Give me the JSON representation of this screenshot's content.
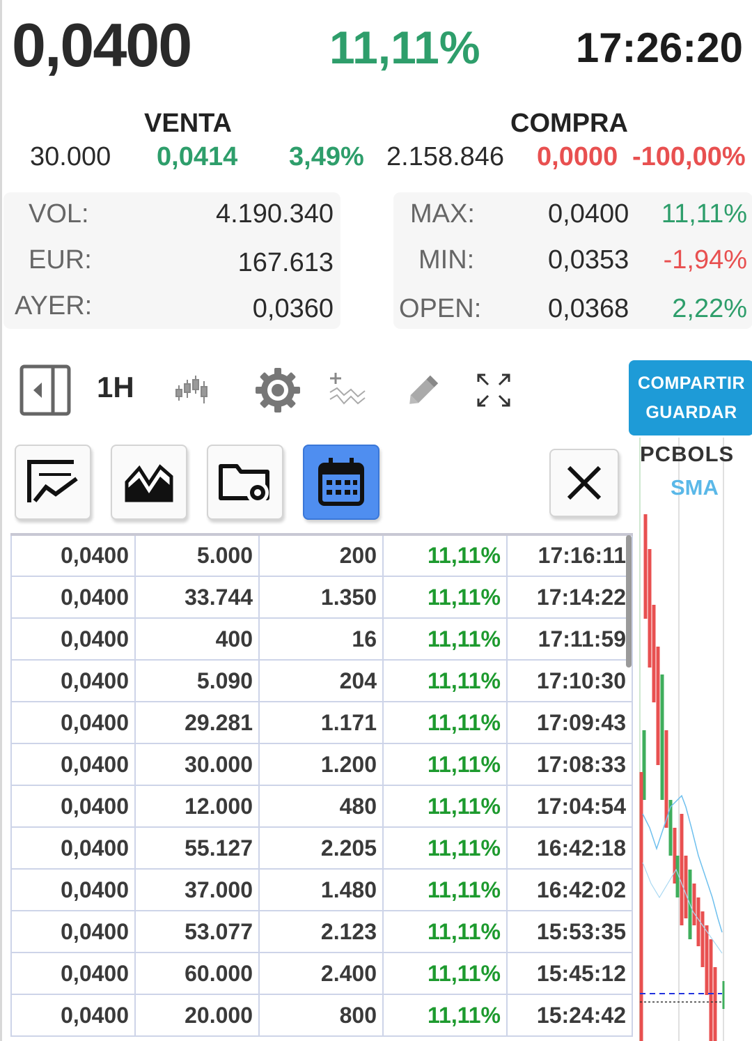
{
  "header": {
    "price": "0,0400",
    "change_pct": "11,11%",
    "time": "17:26:20"
  },
  "bid_ask": {
    "sell_title": "VENTA",
    "buy_title": "COMPRA",
    "sell_volume": "30.000",
    "sell_price": "0,0414",
    "sell_pct": "3,49%",
    "buy_volume": "2.158.846",
    "buy_price": "0,0000",
    "buy_pct": "-100,00%"
  },
  "stats_left": [
    {
      "label": "VOL:",
      "value": "4.190.340"
    },
    {
      "label": "EUR:",
      "value": "167.613"
    },
    {
      "label": "AYER:",
      "value": "0,0360"
    }
  ],
  "stats_right": [
    {
      "label": "MAX:",
      "value": "0,0400",
      "pct": "11,11%",
      "color": "#2e9e6b"
    },
    {
      "label": "MIN:",
      "value": "0,0353",
      "pct": "-1,94%",
      "color": "#e85050"
    },
    {
      "label": "OPEN:",
      "value": "0,0368",
      "pct": "2,22%",
      "color": "#2e9e6b"
    }
  ],
  "toolbar": {
    "interval": "1H",
    "icons": [
      "panel-toggle-icon",
      "candlestick-icon",
      "gear-icon",
      "add-indicator-icon",
      "pencil-icon",
      "fullscreen-icon"
    ],
    "share_line1": "COMPARTIR",
    "share_line2": "GUARDAR"
  },
  "actions": {
    "icons": [
      "line-chart-icon",
      "area-chart-icon",
      "folder-settings-icon",
      "calendar-icon",
      "close-icon"
    ],
    "active": "calendar-icon",
    "active_color": "#4f8ef0"
  },
  "mini_chart": {
    "symbol": "PCBOLS",
    "indicator": "SMA"
  },
  "trades": [
    [
      "0,0400",
      "5.000",
      "200",
      "11,11%",
      "17:16:11"
    ],
    [
      "0,0400",
      "33.744",
      "1.350",
      "11,11%",
      "17:14:22"
    ],
    [
      "0,0400",
      "400",
      "16",
      "11,11%",
      "17:11:59"
    ],
    [
      "0,0400",
      "5.090",
      "204",
      "11,11%",
      "17:10:30"
    ],
    [
      "0,0400",
      "29.281",
      "1.171",
      "11,11%",
      "17:09:43"
    ],
    [
      "0,0400",
      "30.000",
      "1.200",
      "11,11%",
      "17:08:33"
    ],
    [
      "0,0400",
      "12.000",
      "480",
      "11,11%",
      "17:04:54"
    ],
    [
      "0,0400",
      "55.127",
      "2.205",
      "11,11%",
      "16:42:18"
    ],
    [
      "0,0400",
      "37.000",
      "1.480",
      "11,11%",
      "16:42:02"
    ],
    [
      "0,0400",
      "53.077",
      "2.123",
      "11,11%",
      "15:53:35"
    ],
    [
      "0,0400",
      "60.000",
      "2.400",
      "11,11%",
      "15:45:12"
    ],
    [
      "0,0400",
      "20.000",
      "800",
      "11,11%",
      "15:24:42"
    ]
  ],
  "colors": {
    "up": "#2e9e6b",
    "down": "#e85050",
    "table_pct": "#1d9a2e",
    "share_button": "#1e9bd7"
  }
}
